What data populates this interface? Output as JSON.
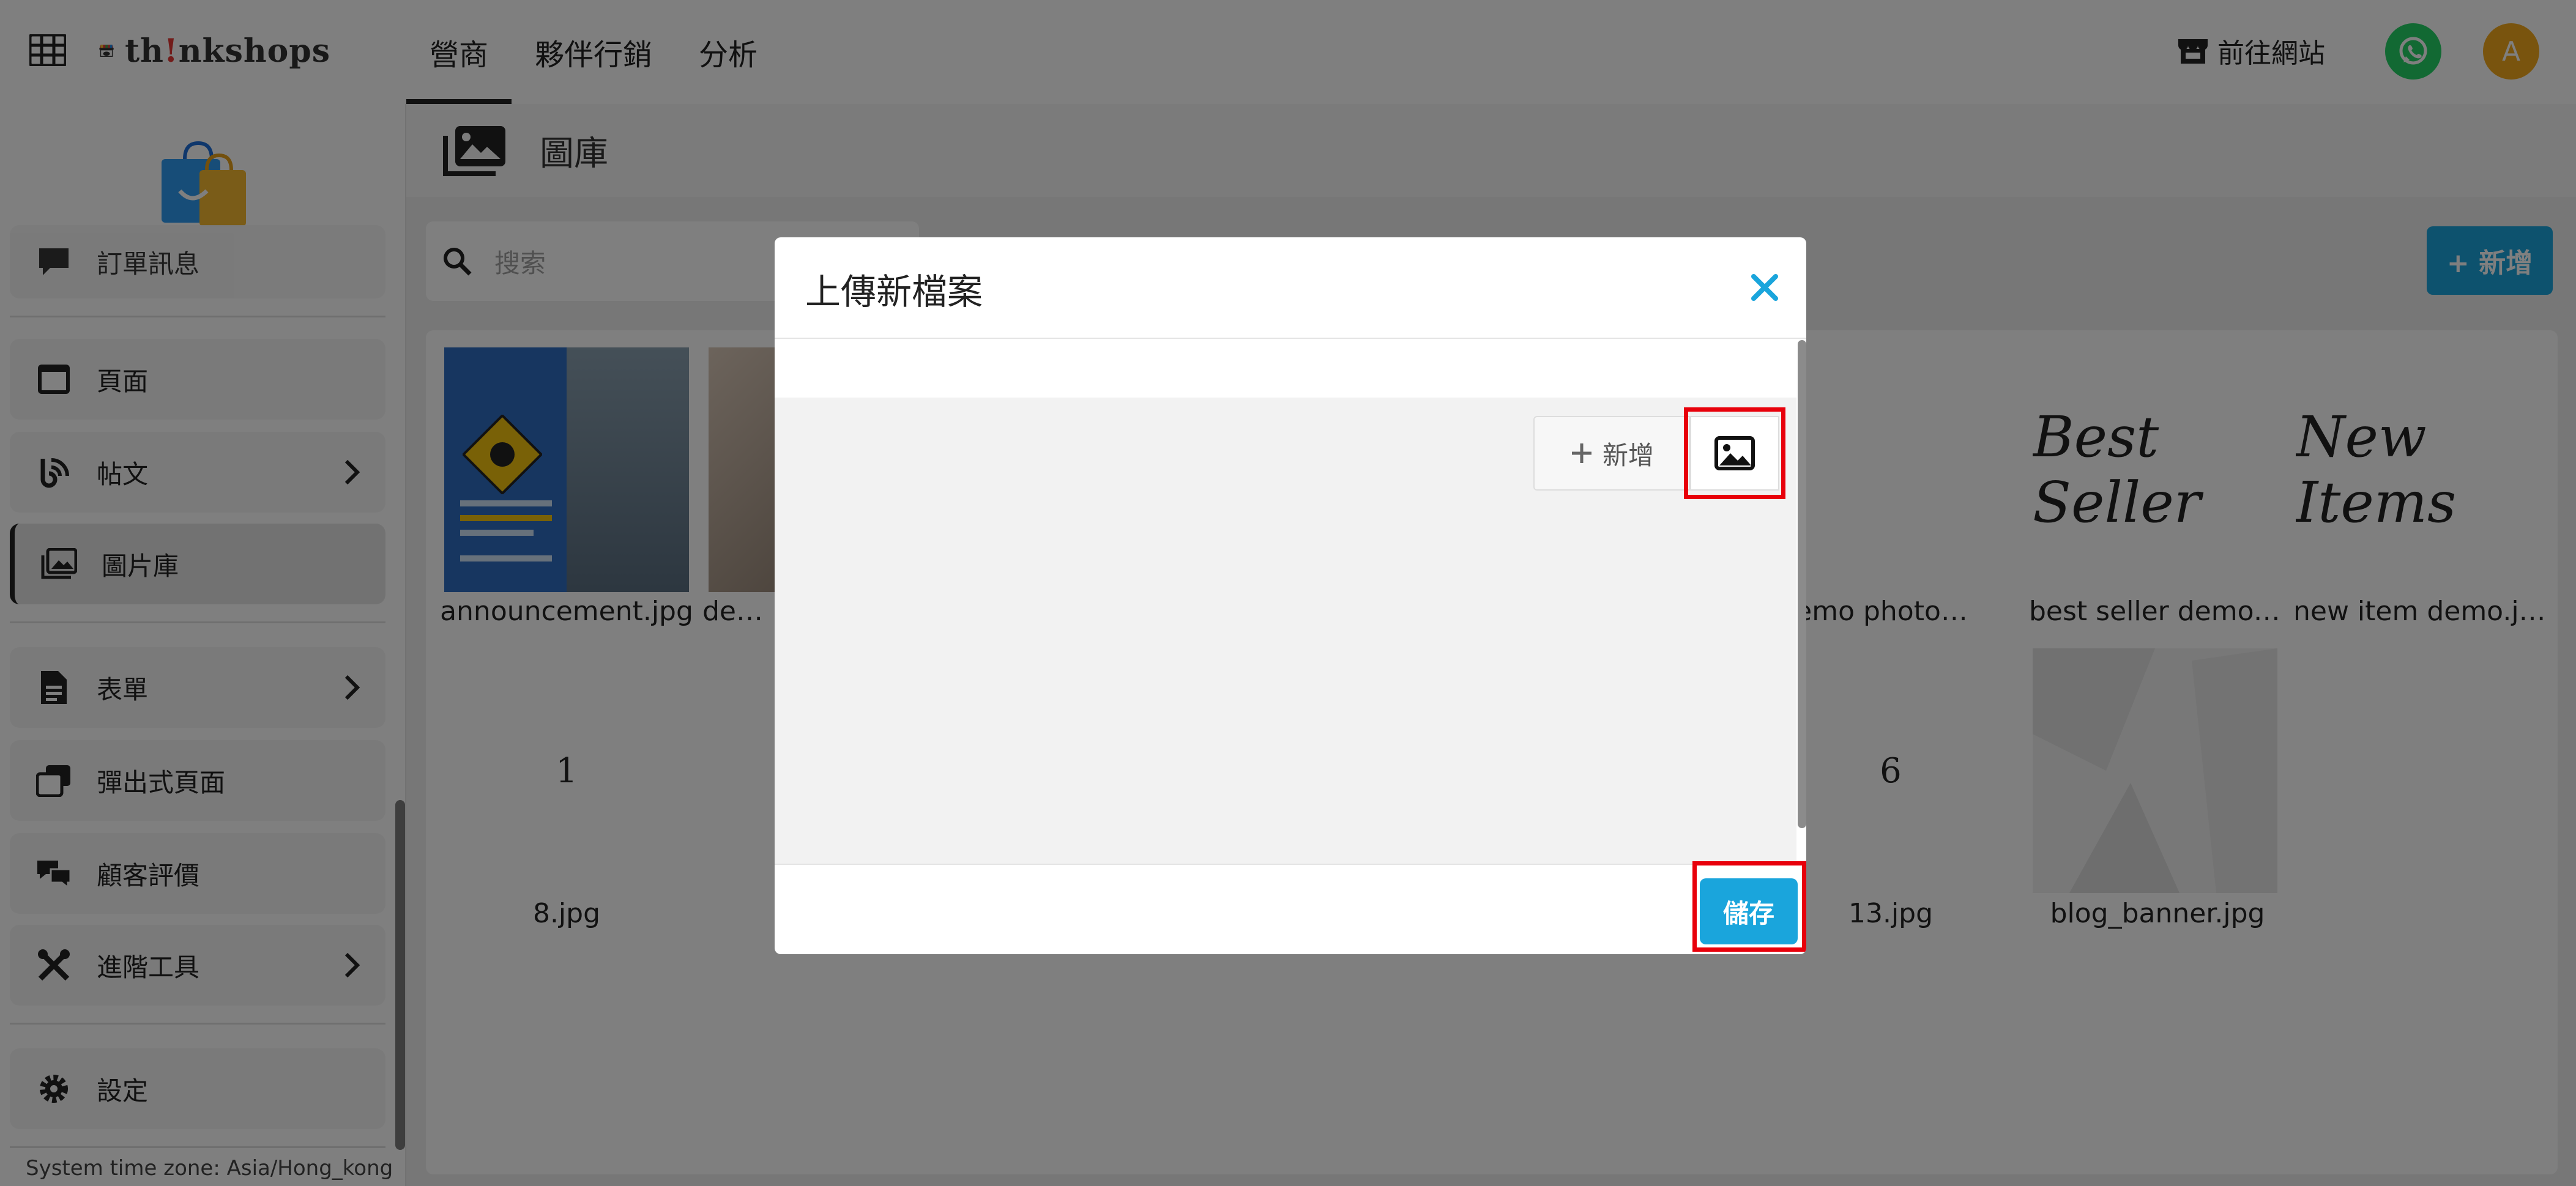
{
  "topbar": {
    "brand": "th!nkshops",
    "tabs": [
      "營商",
      "夥伴行銷",
      "分析"
    ],
    "goto_site": "前往網站",
    "avatar_initial": "A",
    "icons": {
      "grid": "grid-icon",
      "whatsapp": "whatsapp-icon",
      "store": "store-icon"
    }
  },
  "sidebar": {
    "partial_item": "訂單訊息",
    "items": [
      {
        "label": "頁面",
        "icon": "page-icon"
      },
      {
        "label": "帖文",
        "icon": "blog-icon"
      },
      {
        "label": "圖片庫",
        "icon": "gallery-icon"
      },
      {
        "label": "表單",
        "icon": "form-icon"
      },
      {
        "label": "彈出式頁面",
        "icon": "popup-icon"
      },
      {
        "label": "顧客評價",
        "icon": "reviews-icon"
      },
      {
        "label": "進階工具",
        "icon": "tools-icon"
      },
      {
        "label": "設定",
        "icon": "gear-icon"
      }
    ],
    "timezone": "System time zone: Asia/Hong_kong"
  },
  "main": {
    "title": "圖庫",
    "search_placeholder": "搜索",
    "add_button": "+ 新增"
  },
  "gallery": {
    "row1": [
      {
        "name": "announcement.jpg",
        "kind": "announcement"
      },
      {
        "name": "demo",
        "kind": "photo"
      },
      {
        "name": "l demo photo ...",
        "kind": "none"
      },
      {
        "name": "best seller demo.j...",
        "kind": "script",
        "script_text": "Best Seller"
      },
      {
        "name": "new item demo.jpg",
        "kind": "script",
        "script_text": "New Items"
      }
    ],
    "row2": [
      {
        "name": "8.jpg",
        "kind": "digit",
        "digit": "1"
      },
      {
        "name": "13.jpg",
        "kind": "digit",
        "digit": "6"
      },
      {
        "name": "blog_banner.jpg",
        "kind": "banner"
      }
    ]
  },
  "modal": {
    "title": "上傳新檔案",
    "add_label": "新增",
    "save_label": "儲存",
    "icons": {
      "close": "close-icon",
      "image": "image-icon",
      "plus": "plus-icon"
    }
  },
  "colors": {
    "accent": "#1aa5dc",
    "highlight": "#e8000b",
    "whatsapp": "#25d366",
    "avatar": "#f2a81d"
  }
}
